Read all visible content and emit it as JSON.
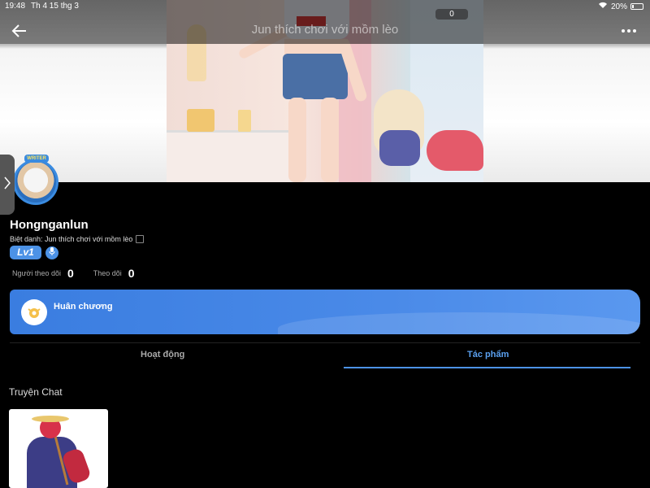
{
  "status_bar": {
    "time": "19:48",
    "date": "Th 4 15 thg 3",
    "battery_percent": "20%",
    "battery_level": 0.2
  },
  "header": {
    "title": "Jun thích chơi với mồm lèo",
    "counter": "0"
  },
  "profile": {
    "username": "Hongnganlun",
    "nickname": "Biệt danh: Jun thích chơi với mồm lèo",
    "level": "Lv1",
    "badge": "WRITER",
    "followers_label": "Người theo dõi",
    "followers_count": "0",
    "following_label": "Theo dõi",
    "following_count": "0"
  },
  "medal": {
    "label": "Huân chương"
  },
  "tabs": [
    {
      "label": "Hoạt động",
      "active": false
    },
    {
      "label": "Tác phẩm",
      "active": true
    }
  ],
  "section": {
    "title": "Truyện Chat"
  },
  "colors": {
    "accent": "#4c92e6",
    "background": "#000000",
    "tab_active": "#5aa0f0"
  },
  "icons": [
    "back-arrow-icon",
    "more-dots-icon",
    "edit-icon",
    "mic-icon",
    "medal-icon",
    "wifi-icon",
    "battery-icon",
    "chevron-right-icon"
  ]
}
